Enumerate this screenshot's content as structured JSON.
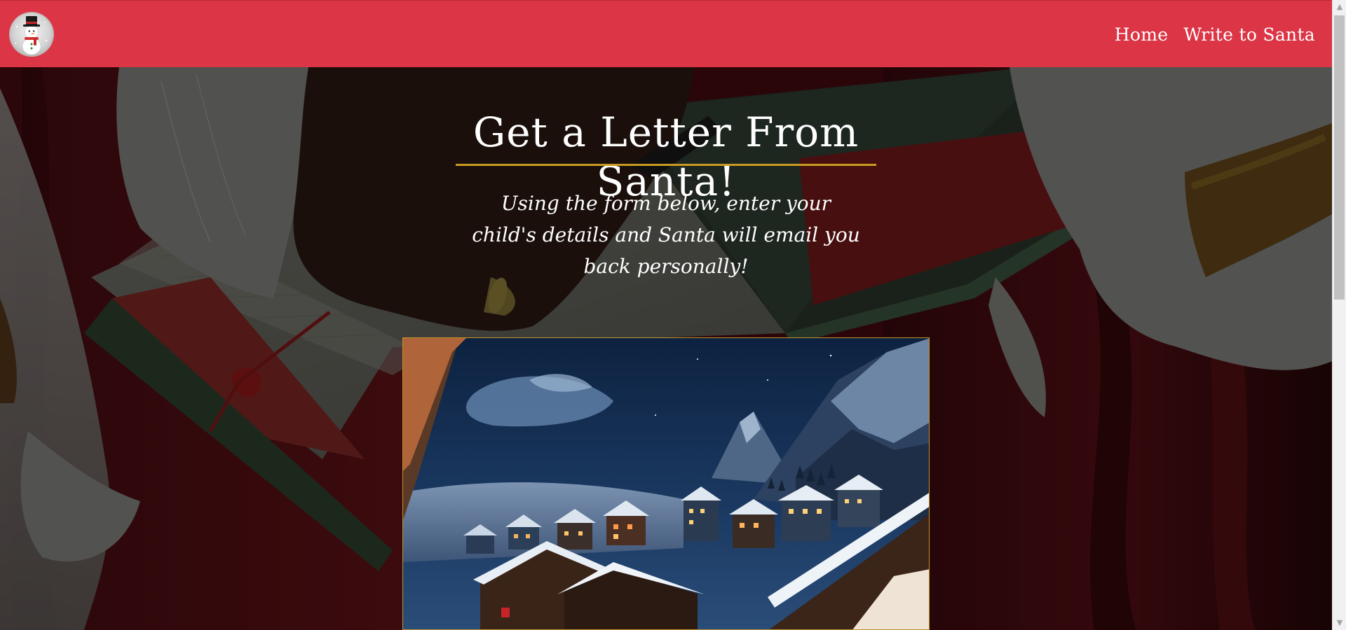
{
  "navbar": {
    "background": "#dc3545",
    "logo_icon": "snowman-icon",
    "links": [
      {
        "label": "Home"
      },
      {
        "label": "Write to Santa"
      }
    ]
  },
  "hero": {
    "title": "Get a Letter From Santa!",
    "subtitle": "Using the form below, enter your child's details and Santa will email you back personally!",
    "accent": "#c79a22",
    "text_color": "#ffffff"
  },
  "scrollbar": {
    "up_arrow": "chevron-up-icon",
    "down_arrow": "chevron-down-icon"
  }
}
